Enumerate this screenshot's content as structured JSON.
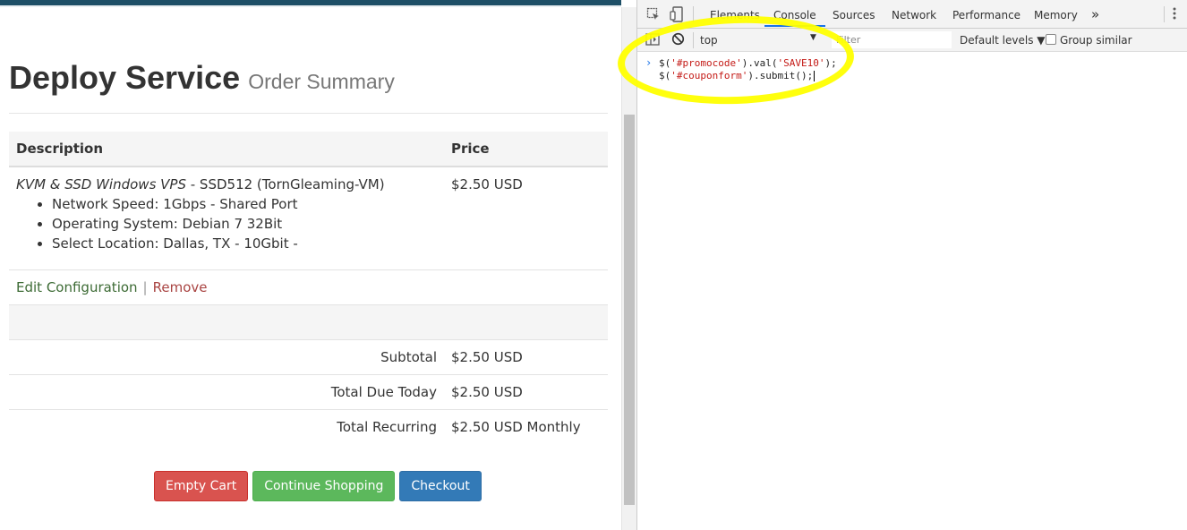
{
  "page": {
    "title": "Deploy Service",
    "subtitle": "Order Summary",
    "table": {
      "col_description": "Description",
      "col_price": "Price"
    },
    "item": {
      "product_italic": "KVM & SSD Windows VPS",
      "product_rest": " - SSD512 (TornGleaming-VM)",
      "price": "$2.50 USD",
      "options": [
        "Network Speed: 1Gbps - Shared Port",
        "Operating System: Debian 7 32Bit",
        "Select Location: Dallas, TX - 10Gbit -"
      ]
    },
    "actions": {
      "edit": "Edit Configuration",
      "separator": "|",
      "remove": "Remove"
    },
    "totals": [
      {
        "label": "Subtotal",
        "value": "$2.50 USD"
      },
      {
        "label": "Total Due Today",
        "value": "$2.50 USD"
      },
      {
        "label": "Total Recurring",
        "value": "$2.50 USD Monthly"
      }
    ],
    "buttons": {
      "empty_cart": "Empty Cart",
      "continue_shopping": "Continue Shopping",
      "checkout": "Checkout"
    }
  },
  "devtools": {
    "tabs": [
      "Elements",
      "Console",
      "Sources",
      "Network",
      "Performance",
      "Memory"
    ],
    "active_tab": "Console",
    "more": "»",
    "context": "top",
    "filter_placeholder": "Filter",
    "levels": "Default levels ▼",
    "group_similar": "Group similar",
    "console_lines": [
      {
        "pre": "$(",
        "s1": "'#promocode'",
        "mid": ").val(",
        "s2": "'SAVE10'",
        "post": ");"
      },
      {
        "pre": "$(",
        "s1": "'#couponform'",
        "mid": ").submit();",
        "s2": "",
        "post": ""
      }
    ]
  },
  "colors": {
    "danger": "#d9534f",
    "success": "#5cb85c",
    "primary": "#337ab7",
    "highlight": "#ffff00"
  }
}
